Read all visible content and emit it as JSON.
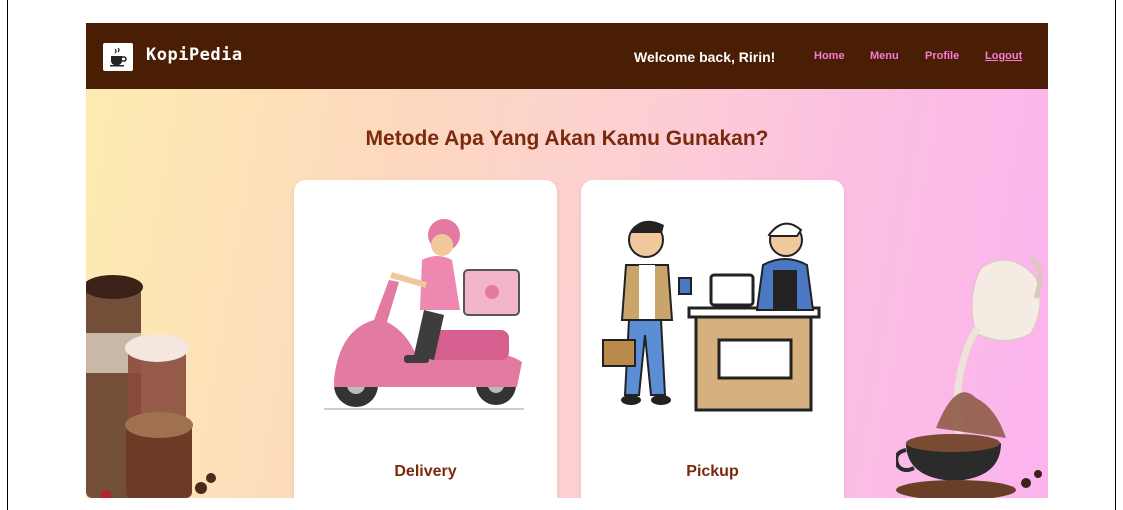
{
  "navbar": {
    "brand": "KopiPedia",
    "welcome": "Welcome back, Ririn!",
    "links": [
      "Home",
      "Menu",
      "Profile",
      "Logout"
    ]
  },
  "main": {
    "heading": "Metode Apa Yang Akan Kamu Gunakan?",
    "options": [
      {
        "label": "Delivery",
        "icon": "scooter-delivery-icon"
      },
      {
        "label": "Pickup",
        "icon": "counter-pickup-icon"
      }
    ]
  },
  "colors": {
    "navbar_bg": "#4a1e05",
    "nav_link": "#f77ad6",
    "heading": "#7a2a0c",
    "gradient_start": "#fdedb0",
    "gradient_end": "#fbb3ee"
  }
}
